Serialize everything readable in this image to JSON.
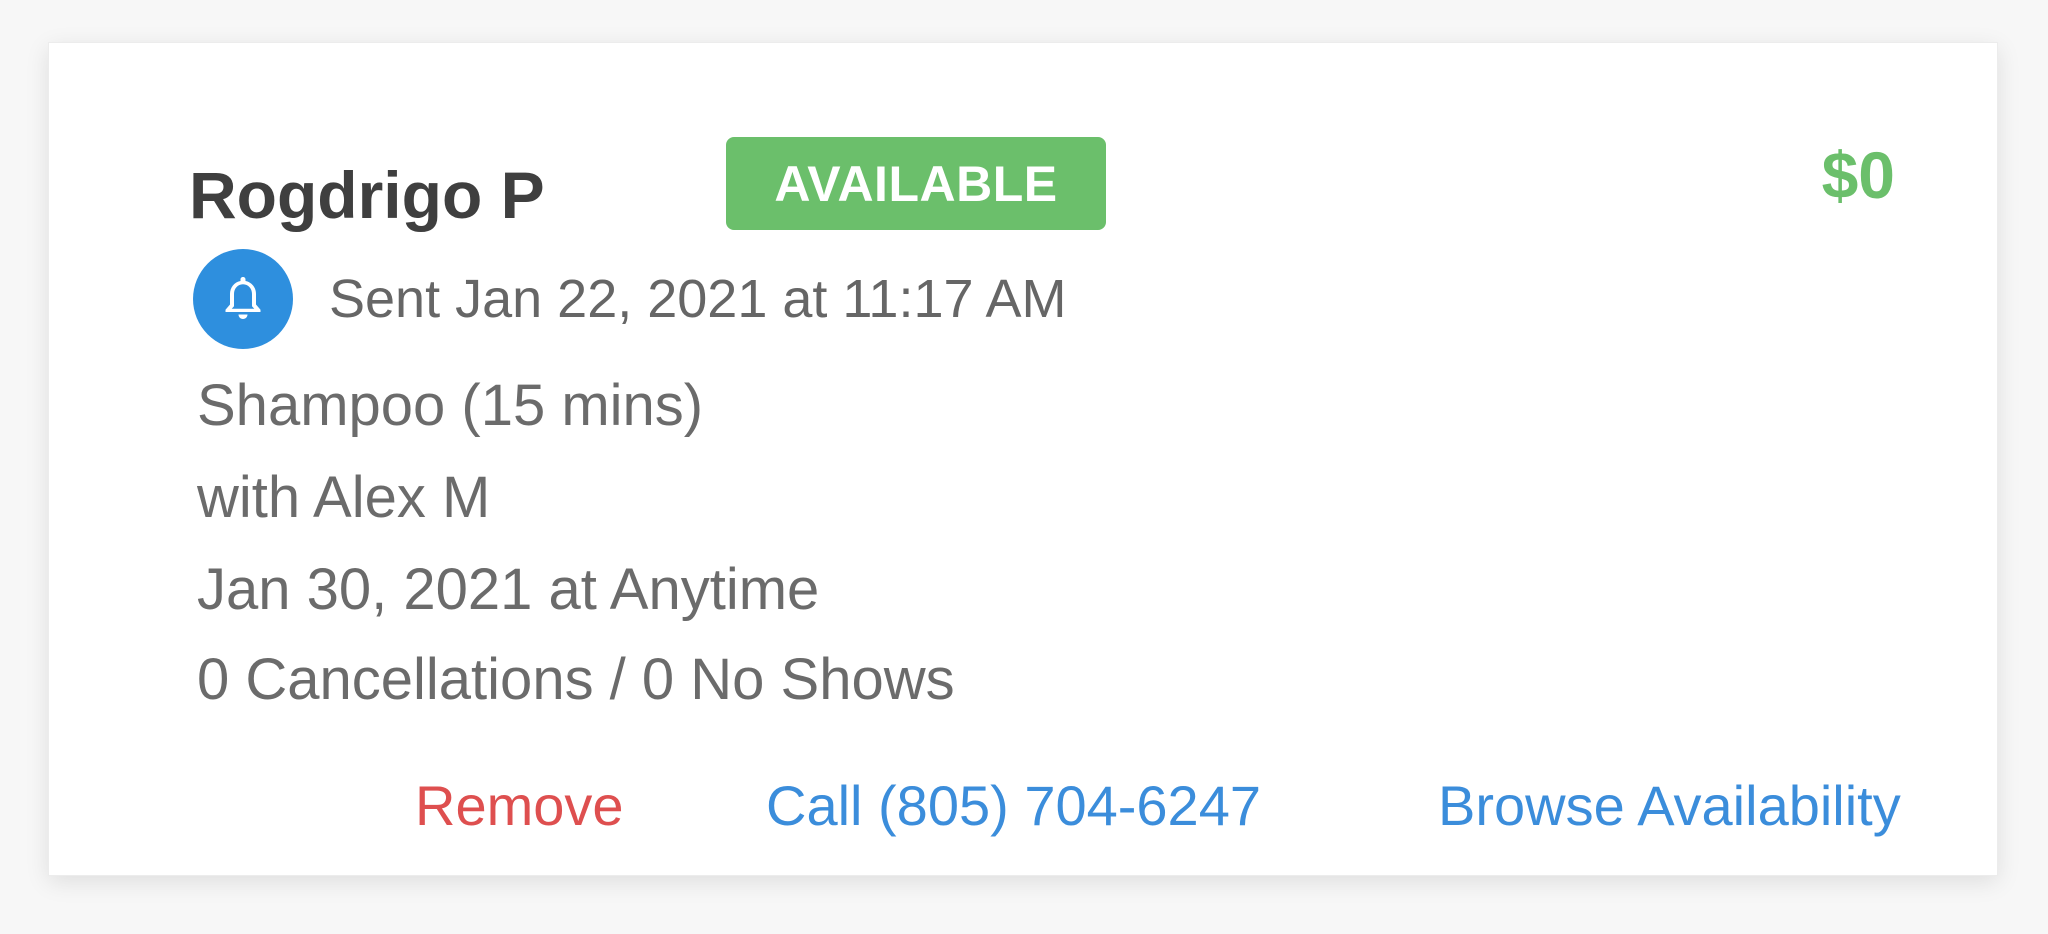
{
  "card": {
    "client_name": "Rogdrigo P",
    "status_badge": "AVAILABLE",
    "price": "$0",
    "notification": {
      "icon": "bell-icon",
      "sent_text": "Sent Jan 22, 2021 at 11:17 AM"
    },
    "service": "Shampoo (15 mins)",
    "staff": "with Alex M",
    "date": "Jan 30, 2021 at Anytime",
    "history": "0 Cancellations / 0 No Shows",
    "actions": {
      "remove": "Remove",
      "call": "Call (805) 704-6247",
      "browse": "Browse Availability"
    }
  },
  "colors": {
    "available_green": "#6bbf6b",
    "link_blue": "#3b8ddb",
    "remove_red": "#de4f4f",
    "bell_blue": "#2e8fde"
  }
}
